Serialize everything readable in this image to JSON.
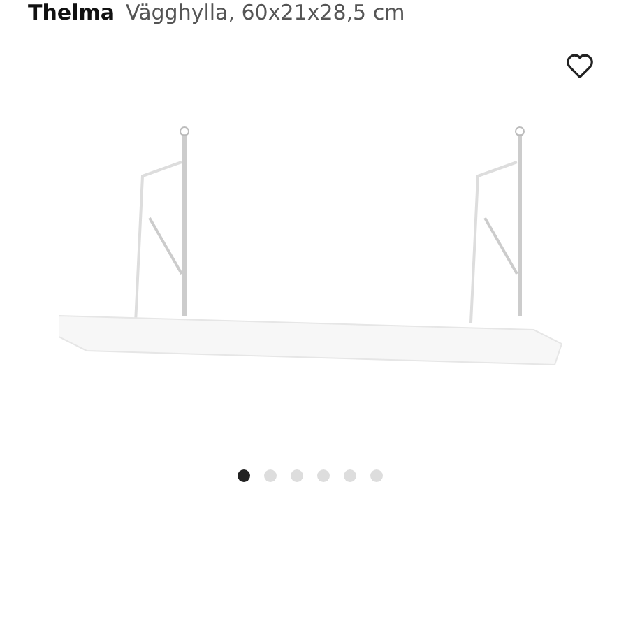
{
  "product": {
    "brand": "Thelma",
    "name": "Vägghylla, 60x21x28,5 cm",
    "favorite": false
  },
  "carousel": {
    "dots": [
      {
        "selected": true
      },
      {
        "selected": false
      },
      {
        "selected": false
      },
      {
        "selected": false
      },
      {
        "selected": false
      },
      {
        "selected": false
      }
    ]
  }
}
